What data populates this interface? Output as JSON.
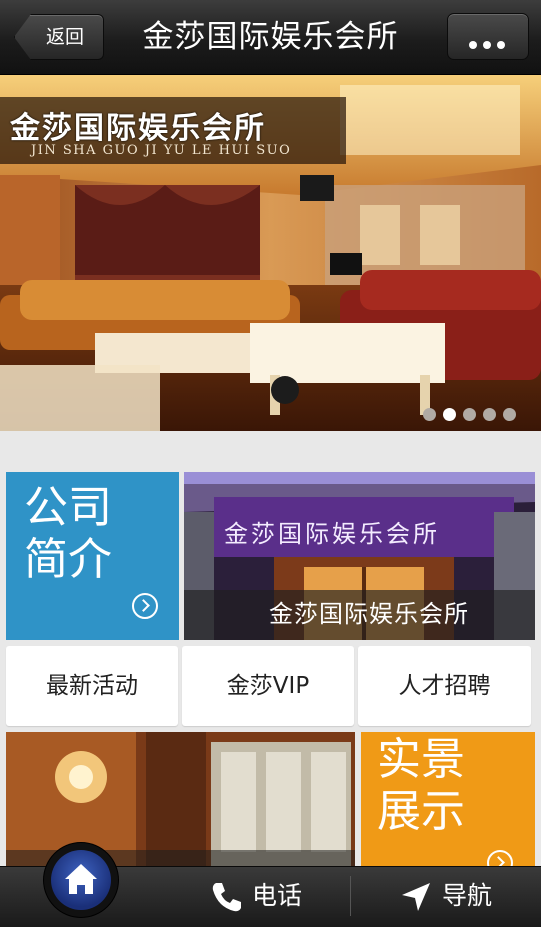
{
  "header": {
    "back_label": "返回",
    "title": "金莎国际娱乐会所",
    "more_icon": "more-dots-icon"
  },
  "banner": {
    "logo_cn": "金莎国际娱乐会所",
    "logo_en": "JIN SHA GUO JI YU LE HUI SUO",
    "slide_count": 5,
    "active_slide": 2
  },
  "tiles": {
    "intro_label": "公司简介",
    "intro_line1": "公司",
    "intro_line2": "简介",
    "intro_color": "#2f93c7",
    "photo_caption": "金莎国际娱乐会所",
    "photo_sign": "金莎国际娱乐会所",
    "scene_line1": "实景",
    "scene_line2": "展示",
    "scene_color": "#f09a16"
  },
  "buttons": {
    "latest": "最新活动",
    "vip": "金莎VIP",
    "jobs": "人才招聘"
  },
  "bottom_bar": {
    "home_icon": "home-icon",
    "phone_icon": "phone-icon",
    "phone_label": "电话",
    "nav_icon": "navigation-arrow-icon",
    "nav_label": "导航"
  }
}
